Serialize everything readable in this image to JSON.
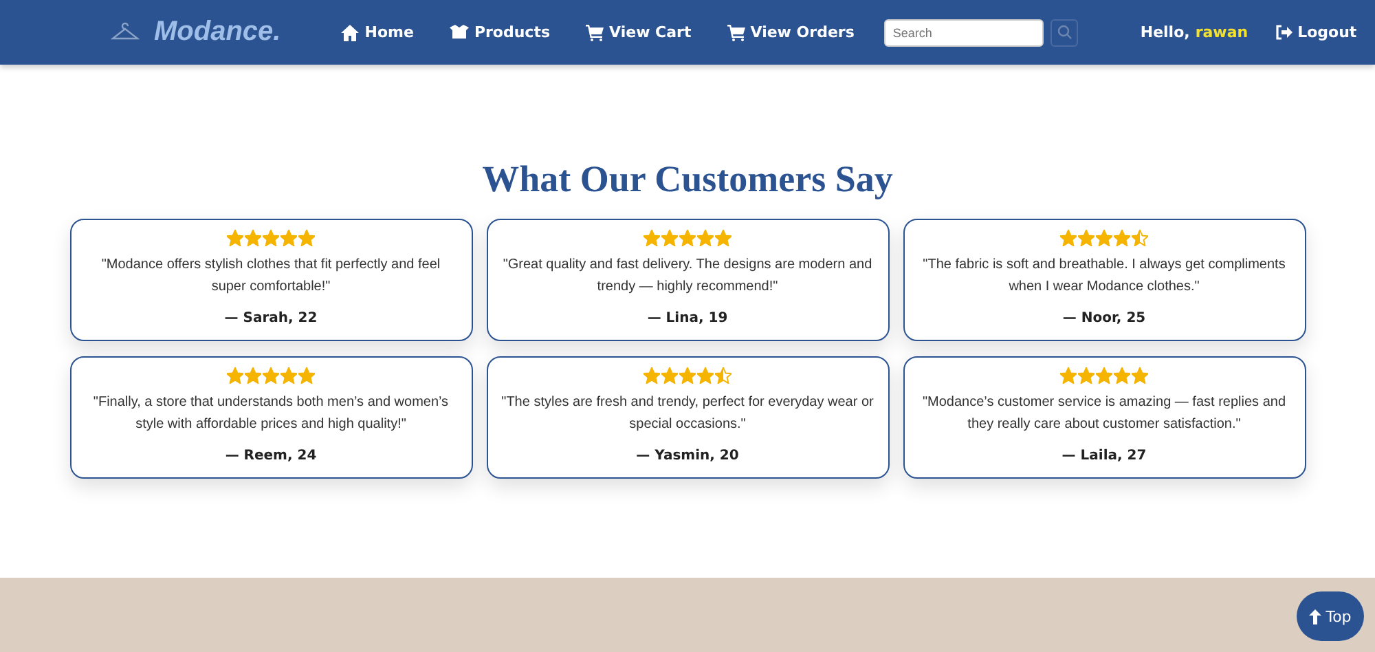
{
  "navbar": {
    "brand": "Modance.",
    "links": [
      {
        "label": "Home",
        "kind": "home"
      },
      {
        "label": "Products",
        "kind": "products"
      },
      {
        "label": "View Cart",
        "kind": "cart"
      },
      {
        "label": "View Orders",
        "kind": "orders"
      }
    ],
    "search": {
      "placeholder": "Search"
    },
    "greeting": "Hello,",
    "username": "rawan",
    "logout": "Logout"
  },
  "section": {
    "title": "What Our Customers Say"
  },
  "reviews": [
    {
      "stars": 5,
      "quote": "\"Modance offers stylish clothes that fit perfectly and feel super comfortable!\"",
      "author": "— Sarah, 22"
    },
    {
      "stars": 5,
      "quote": "\"Great quality and fast delivery. The designs are modern and trendy — highly recommend!\"",
      "author": "— Lina, 19"
    },
    {
      "stars": 4.5,
      "quote": "\"The fabric is soft and breathable. I always get compliments when I wear Modance clothes.\"",
      "author": "— Noor, 25"
    },
    {
      "stars": 5,
      "quote": "\"Finally, a store that understands both men’s and women’s style with affordable prices and high quality!\"",
      "author": "— Reem, 24"
    },
    {
      "stars": 4.5,
      "quote": "\"The styles are fresh and trendy, perfect for everyday wear or special occasions.\"",
      "author": "— Yasmin, 20"
    },
    {
      "stars": 5,
      "quote": "\"Modance’s customer service is amazing — fast replies and they really care about customer satisfaction.\"",
      "author": "— Laila, 27"
    }
  ],
  "top_button": {
    "label": "Top"
  }
}
